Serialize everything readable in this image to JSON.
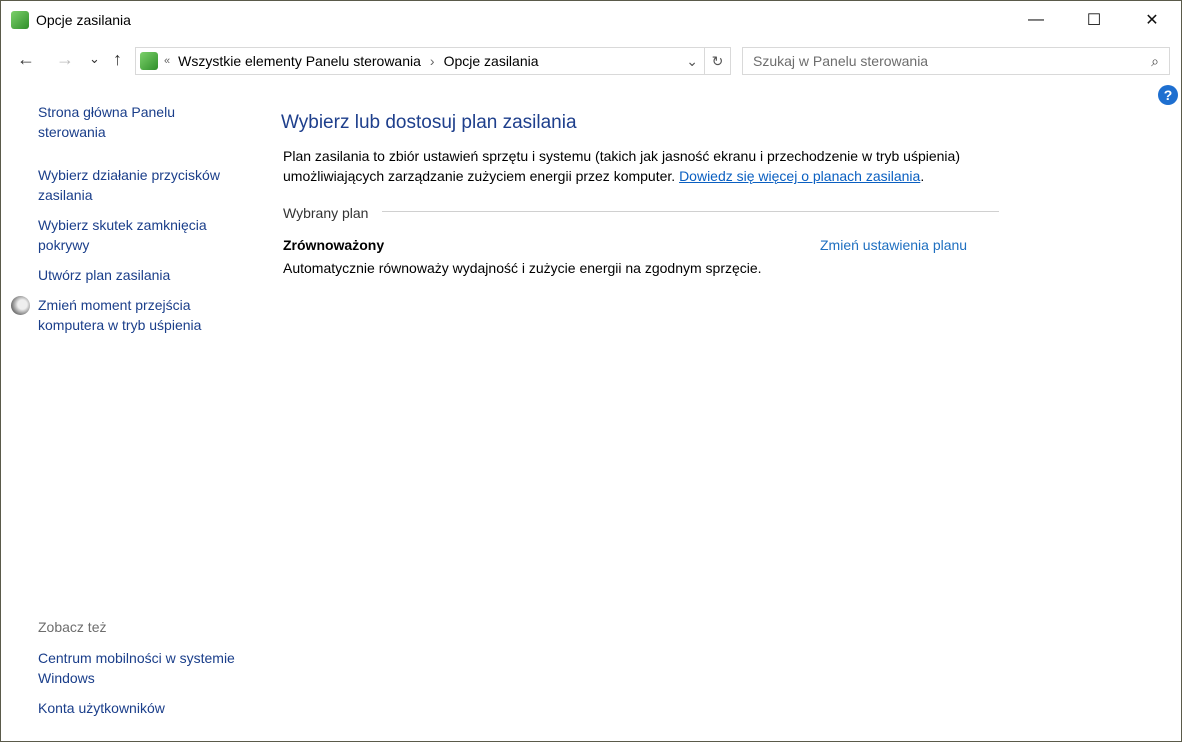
{
  "window": {
    "title": "Opcje zasilania",
    "minimize": "—",
    "maximize": "☐",
    "close": "✕"
  },
  "nav": {
    "back": "←",
    "forward": "→",
    "recent": "⌄",
    "up": "↑",
    "refresh": "↻",
    "breadcrumb": [
      "Wszystkie elementy Panelu sterowania",
      "Opcje zasilania"
    ],
    "overflow": "«",
    "separator": "›",
    "dropdown": "⌄",
    "search_placeholder": "Szukaj w Panelu sterowania",
    "search_icon": "⌕"
  },
  "help": "?",
  "sidebar": {
    "links": [
      "Strona główna Panelu sterowania",
      "Wybierz działanie przycisków zasilania",
      "Wybierz skutek zamknięcia pokrywy",
      "Utwórz plan zasilania",
      "Zmień moment przejścia komputera w tryb uśpienia"
    ],
    "see_also": "Zobacz też",
    "see_also_links": [
      "Centrum mobilności w systemie Windows",
      "Konta użytkowników"
    ]
  },
  "main": {
    "heading": "Wybierz lub dostosuj plan zasilania",
    "description": "Plan zasilania to zbiór ustawień sprzętu i systemu (takich jak jasność ekranu i przechodzenie w tryb uśpienia) umożliwiających zarządzanie zużyciem energii przez komputer. ",
    "learn_more": "Dowiedz się więcej o planach zasilania",
    "period": ".",
    "group_label": "Wybrany plan",
    "plan_name": "Zrównoważony",
    "plan_change": "Zmień ustawienia planu",
    "plan_description": "Automatycznie równoważy wydajność i zużycie energii na zgodnym sprzęcie."
  }
}
